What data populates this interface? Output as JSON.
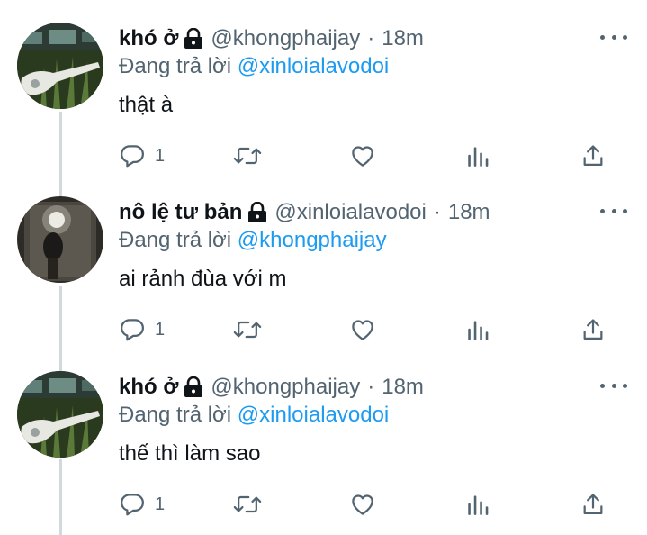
{
  "tweets": [
    {
      "name": "khó ở",
      "handle": "@khongphaijay",
      "separator": "·",
      "time": "18m",
      "replying_prefix": "Đang trả lời",
      "replying_to": "@xinloialavodoi",
      "text": "thật à",
      "reply_count": "1",
      "avatar": "guitar-photo"
    },
    {
      "name": "nô lệ tư bản",
      "handle": "@xinloialavodoi",
      "separator": "·",
      "time": "18m",
      "replying_prefix": "Đang trả lời",
      "replying_to": "@khongphaijay",
      "text": "ai rảnh đùa với m",
      "reply_count": "1",
      "avatar": "mirror-selfie-photo"
    },
    {
      "name": "khó ở",
      "handle": "@khongphaijay",
      "separator": "·",
      "time": "18m",
      "replying_prefix": "Đang trả lời",
      "replying_to": "@xinloialavodoi",
      "text": "thế thì làm sao",
      "reply_count": "1",
      "avatar": "guitar-photo"
    }
  ],
  "icons": [
    "lock-icon",
    "more-icon",
    "reply-icon",
    "retweet-icon",
    "like-icon",
    "analytics-icon",
    "share-icon"
  ],
  "colors": {
    "text": "#0f1419",
    "secondary": "#536471",
    "link": "#1d9bf0",
    "thread": "#cfd9de"
  }
}
